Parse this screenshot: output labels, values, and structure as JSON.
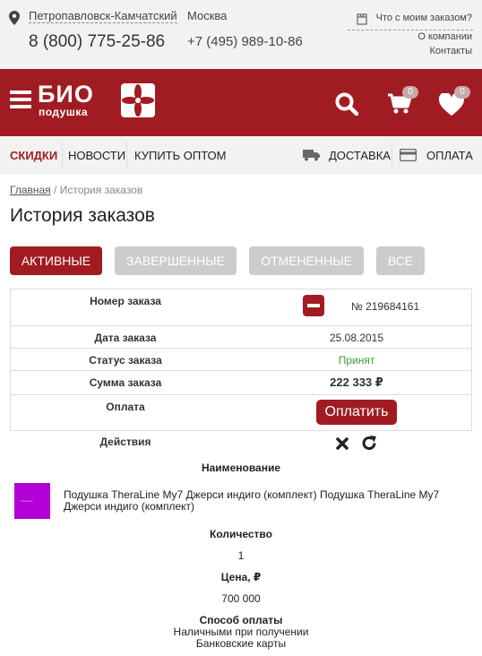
{
  "topbar": {
    "city": "Петропавловск-Камчатский",
    "phone_main": "8 (800) 775-25-86",
    "city2": "Москва",
    "phone_moscow": "+7 (495) 989-10-86",
    "order_status_link": "Что с моим заказом?",
    "about_link": "О компании",
    "contacts_link": "Контакты"
  },
  "header": {
    "logo_big": "БИО",
    "logo_small": "подушка",
    "cart_count": "0",
    "fav_count": "0",
    "brand_color": "#a11c22"
  },
  "nav": {
    "sale": "СКИДКИ",
    "news": "НОВОСТИ",
    "wholesale": "КУПИТЬ ОПТОМ",
    "delivery": "ДОСТАВКА",
    "payment": "ОПЛАТА"
  },
  "breadcrumb": {
    "home": "Главная",
    "separator": "/",
    "current": "История заказов"
  },
  "page_title": "История заказов",
  "filters": {
    "active": "АКТИВНЫЕ",
    "completed": "ЗАВЕРШЕННЫЕ",
    "cancelled": "ОТМЕНЕННЫЕ",
    "all": "ВСЕ"
  },
  "order": {
    "number_label": "Номер заказа",
    "number_value": "№ 219684161",
    "date_label": "Дата заказа",
    "date_value": "25.08.2015",
    "status_label": "Статус заказа",
    "status_value": "Принят",
    "sum_label": "Сумма заказа",
    "sum_value": "222 333 ₽",
    "payment_label": "Оплата",
    "pay_button": "Оплатить",
    "actions_label": "Действия"
  },
  "items": {
    "name_header": "Наименование",
    "product_name": "Подушка TheraLine My7 Джерси индиго (комплект) Подушка TheraLine My7 Джерси индиго (комплект)",
    "qty_header": "Количество",
    "qty_value": "1",
    "price_header": "Цена, ₽",
    "price_value": "700 000",
    "pay_method_header": "Способ оплаты",
    "pay_method_1": "Наличными при получении",
    "pay_method_2": "Банковские карты"
  }
}
